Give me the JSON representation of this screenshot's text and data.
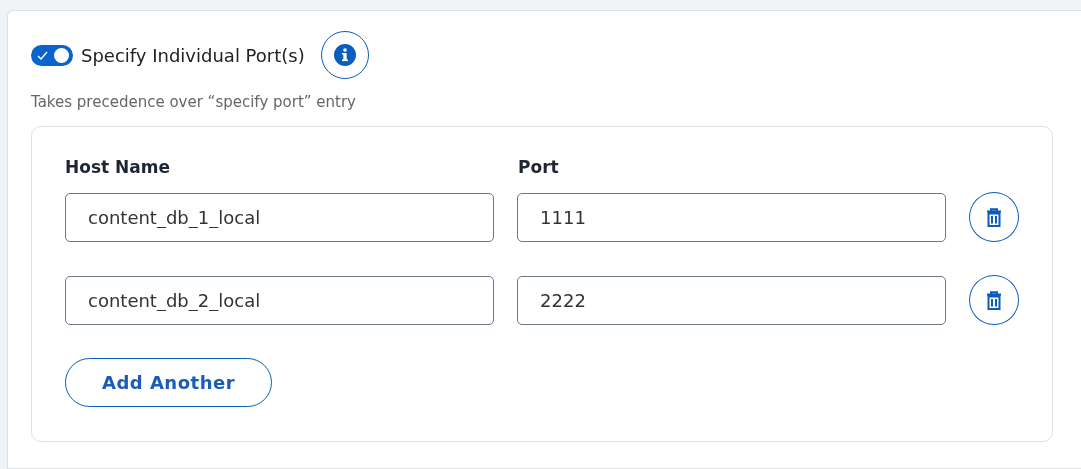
{
  "toggle": {
    "label": "Specify Individual Port(s)",
    "on": true
  },
  "hint": "Takes precedence over “specify port” entry",
  "columns": [
    "Host Name",
    "Port"
  ],
  "rows": [
    {
      "host": "content_db_1_local",
      "port": "1111"
    },
    {
      "host": "content_db_2_local",
      "port": "2222"
    }
  ],
  "add_button": "Add Another"
}
